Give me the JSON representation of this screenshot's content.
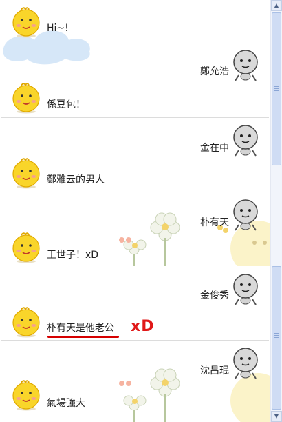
{
  "top_panel": {
    "messages": [
      {
        "text": "Hi~!"
      },
      {
        "text": "鄭允浩"
      },
      {
        "text": "係豆包！"
      },
      {
        "text": "金在中"
      },
      {
        "text": "鄭雅云的男人"
      },
      {
        "text": "朴有天"
      },
      {
        "text": "王世子！xD"
      }
    ]
  },
  "bottom_panel": {
    "messages": [
      {
        "text": "金俊秀"
      },
      {
        "text": "朴有天是他老公"
      },
      {
        "text": "沈昌珉"
      },
      {
        "text": "氣場強大"
      }
    ],
    "annotation": "xD",
    "annotation_color": "#e01818"
  },
  "icons": {
    "user_avatar": "yellow-chick-icon",
    "bot_avatar": "gray-robot-icon"
  },
  "colors": {
    "underline": "#d60000",
    "scrollbar_thumb": "#cfdcf4"
  }
}
